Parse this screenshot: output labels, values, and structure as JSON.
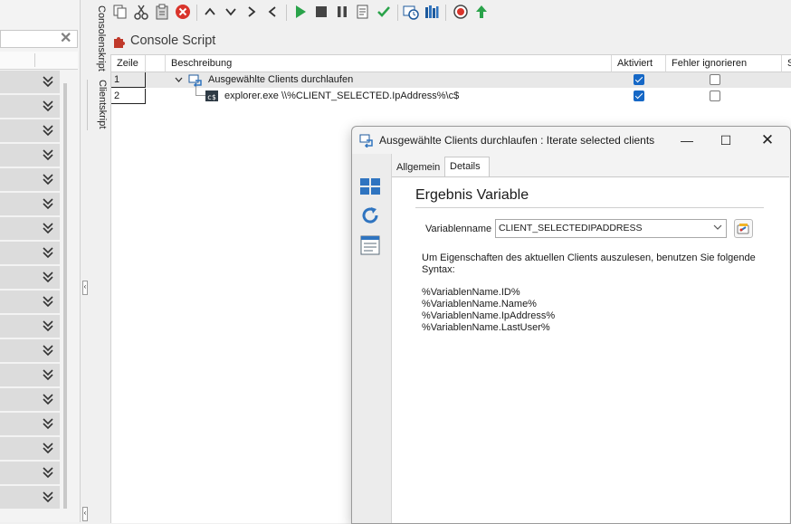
{
  "toolbar": {
    "icons": [
      "copy-icon",
      "cut-icon",
      "paste-icon",
      "delete-icon",
      "move-up-icon",
      "move-down-icon",
      "indent-icon",
      "outdent-icon",
      "run-icon",
      "stop-icon",
      "pause-icon",
      "log-icon",
      "validate-icon",
      "schedule-icon",
      "library-icon",
      "record-icon",
      "upload-icon"
    ]
  },
  "vertical_tabs": {
    "console": "Consolenskript",
    "client": "Clientskript"
  },
  "script_title": "Console Script",
  "grid": {
    "columns": {
      "zeile": "Zeile",
      "beschreibung": "Beschreibung",
      "aktiviert": "Aktiviert",
      "fehler": "Fehler ignorieren",
      "extra": "S"
    },
    "rows": [
      {
        "zeile": "1",
        "beschreibung": "Ausgewählte Clients durchlaufen",
        "aktiviert": true,
        "fehler": false
      },
      {
        "zeile": "2",
        "beschreibung": "explorer.exe \\\\%CLIENT_SELECTED.IpAddress%\\c$",
        "aktiviert": true,
        "fehler": false
      }
    ]
  },
  "dialog": {
    "title": "Ausgewählte Clients durchlaufen : Iterate selected clients",
    "tabs": {
      "allgemein": "Allgemein",
      "details": "Details"
    },
    "section_title": "Ergebnis Variable",
    "variable_label": "Variablenname",
    "variable_value": "CLIENT_SELECTEDIPADDRESS",
    "info": "Um Eigenschaften des aktuellen Clients auszulesen, benutzen Sie folgende Syntax:",
    "syntax_lines": [
      "%VariablenName.ID%",
      "%VariablenName.Name%",
      "%VariablenName.IpAddress%",
      "%VariablenName.LastUser%"
    ]
  },
  "colors": {
    "accent": "#1668c6",
    "selected_row": "#e8e8e8",
    "run_green": "#2aa34a",
    "delete_red": "#d9342b"
  }
}
